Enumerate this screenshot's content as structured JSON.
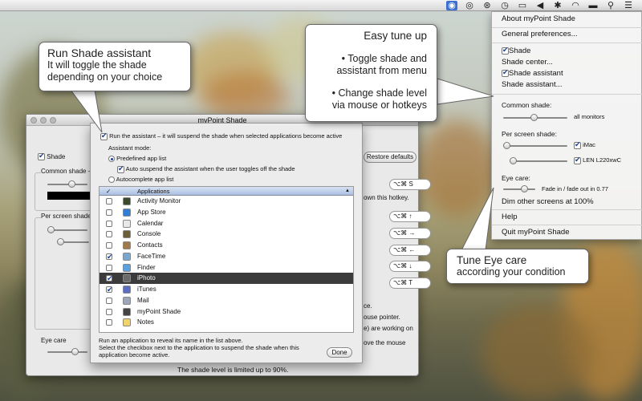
{
  "menubar": {
    "icons": [
      "mypoint-shade-icon",
      "target-icon",
      "accessibility-icon",
      "time-machine-icon",
      "display-icon",
      "volume-icon",
      "bluetooth-icon",
      "wifi-icon",
      "battery-icon",
      "spotlight-icon",
      "list-icon"
    ]
  },
  "window": {
    "title": "myPoint Shade",
    "shade_label": "Shade",
    "common_shade_label": "Common shade –",
    "per_screen_label": "Per screen shade –",
    "eye_care_label": "Eye care",
    "restore_label": "Restore defaults",
    "hotkeys": [
      "⌥⌘ S",
      "⌥⌘ ↑",
      "⌥⌘ →",
      "⌥⌘ ←",
      "⌥⌘ ↓",
      "⌥⌘ T"
    ],
    "hotkey_hint": "own this hotkey.",
    "frag_1": "ce.",
    "frag_2": "ouse pointer.",
    "frag_3": "e) are working on",
    "frag_4": "ove the mouse",
    "footer": "The shade level is limited up to 90%."
  },
  "sheet": {
    "run_assistant": "Run the assistant – it will suspend the shade when selected applications become active",
    "assistant_mode": "Assistant mode:",
    "predefined": "Predefined app list",
    "auto_suspend": "Auto suspend the assistant when the user toggles off the shade",
    "autocomplete": "Autocomplete app list",
    "list_header": "Applications",
    "apps": [
      {
        "name": "Activity Monitor",
        "checked": false
      },
      {
        "name": "App Store",
        "checked": false
      },
      {
        "name": "Calendar",
        "checked": false
      },
      {
        "name": "Console",
        "checked": false
      },
      {
        "name": "Contacts",
        "checked": false
      },
      {
        "name": "FaceTime",
        "checked": true
      },
      {
        "name": "Finder",
        "checked": false
      },
      {
        "name": "iPhoto",
        "checked": true,
        "selected": true
      },
      {
        "name": "iTunes",
        "checked": true
      },
      {
        "name": "Mail",
        "checked": false
      },
      {
        "name": "myPoint Shade",
        "checked": false
      },
      {
        "name": "Notes",
        "checked": false
      }
    ],
    "help_1": "Run an application to reveal its name in the list above.",
    "help_2": "Select the checkbox next to the application to suspend the shade when this",
    "help_3": "application become active.",
    "done": "Done"
  },
  "menu": {
    "about": "About myPoint Shade",
    "general": "General preferences...",
    "shade": "Shade",
    "shade_center": "Shade center...",
    "shade_assistant": "Shade assistant",
    "shade_assistant_dots": "Shade assistant...",
    "common_shade": "Common shade:",
    "all_monitors": "all monitors",
    "per_screen": "Per screen shade:",
    "imac": "iMac",
    "len": "LEN L220xwC",
    "eye_care": "Eye care:",
    "fade": "Fade in / fade out in 0.77",
    "dim": "Dim other screens at 100%",
    "help": "Help",
    "quit": "Quit myPoint Shade"
  },
  "callouts": {
    "run_shade_1": "Run Shade assistant",
    "run_shade_2": "It will toggle the shade",
    "run_shade_3": "depending on your choice",
    "easy_1": "Easy tune up",
    "easy_2": "• Toggle shade and",
    "easy_3": "assistant from menu",
    "easy_4": "• Change shade level",
    "easy_5": "via mouse or hotkeys",
    "eye_1": "Tune Eye care",
    "eye_2": "according your condition"
  }
}
